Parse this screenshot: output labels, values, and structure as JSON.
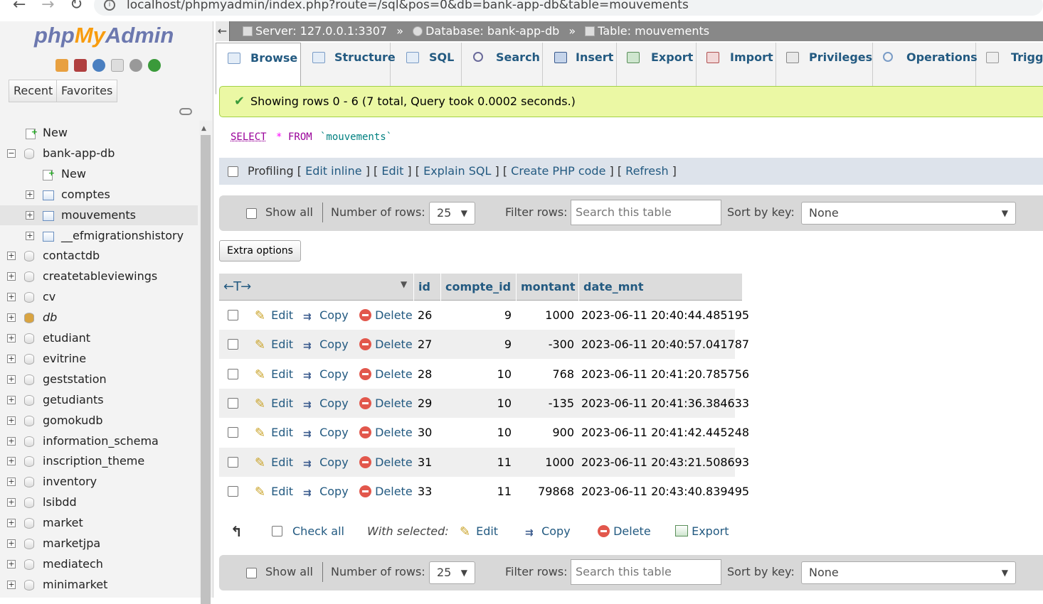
{
  "browser": {
    "back": "←",
    "forward": "→",
    "reload": "↻",
    "url": "localhost/phpmyadmin/index.php?route=/sql&pos=0&db=bank-app-db&table=mouvements"
  },
  "sidebar": {
    "logo": {
      "php": "php",
      "my": "My",
      "admin": "Admin"
    },
    "tabs": [
      "Recent",
      "Favorites"
    ],
    "tree": [
      {
        "label": "New",
        "type": "new",
        "level": 0
      },
      {
        "label": "bank-app-db",
        "type": "db",
        "level": 0,
        "expanded": true
      },
      {
        "label": "New",
        "type": "new",
        "level": 1
      },
      {
        "label": "comptes",
        "type": "table",
        "level": 1
      },
      {
        "label": "mouvements",
        "type": "table",
        "level": 1,
        "selected": true
      },
      {
        "label": "__efmigrationshistory",
        "type": "table",
        "level": 1
      },
      {
        "label": "contactdb",
        "type": "db",
        "level": 0
      },
      {
        "label": "createtableviewings",
        "type": "db",
        "level": 0
      },
      {
        "label": "cv",
        "type": "db",
        "level": 0
      },
      {
        "label": "db",
        "type": "db-special",
        "level": 0
      },
      {
        "label": "etudiant",
        "type": "db",
        "level": 0
      },
      {
        "label": "evitrine",
        "type": "db",
        "level": 0
      },
      {
        "label": "geststation",
        "type": "db",
        "level": 0
      },
      {
        "label": "getudiants",
        "type": "db",
        "level": 0
      },
      {
        "label": "gomokudb",
        "type": "db",
        "level": 0
      },
      {
        "label": "information_schema",
        "type": "db",
        "level": 0
      },
      {
        "label": "inscription_theme",
        "type": "db",
        "level": 0
      },
      {
        "label": "inventory",
        "type": "db",
        "level": 0
      },
      {
        "label": "lsibdd",
        "type": "db",
        "level": 0
      },
      {
        "label": "market",
        "type": "db",
        "level": 0
      },
      {
        "label": "marketjpa",
        "type": "db",
        "level": 0
      },
      {
        "label": "mediatech",
        "type": "db",
        "level": 0
      },
      {
        "label": "minimarket",
        "type": "db",
        "level": 0
      }
    ]
  },
  "breadcrumb": {
    "server": "Server: 127.0.0.1:3307",
    "database": "Database: bank-app-db",
    "table": "Table: mouvements",
    "sep": "»"
  },
  "tabs": [
    "Browse",
    "Structure",
    "SQL",
    "Search",
    "Insert",
    "Export",
    "Import",
    "Privileges",
    "Operations",
    "Trigge"
  ],
  "message": "Showing rows 0 - 6 (7 total, Query took 0.0002 seconds.)",
  "sql": {
    "select": "SELECT",
    "star": "*",
    "from": "FROM",
    "table": "`mouvements`"
  },
  "profiling": {
    "label": "Profiling",
    "links": [
      "Edit inline",
      "Edit",
      "Explain SQL",
      "Create PHP code",
      "Refresh"
    ]
  },
  "navbar": {
    "show_all": "Show all",
    "rows_label": "Number of rows:",
    "rows_value": "25",
    "filter_label": "Filter rows:",
    "filter_placeholder": "Search this table",
    "sort_label": "Sort by key:",
    "sort_value": "None"
  },
  "extra_options": "Extra options",
  "grid": {
    "arrows": "←T→",
    "columns": [
      "id",
      "compte_id",
      "montant",
      "date_mnt"
    ],
    "actions": {
      "edit": "Edit",
      "copy": "Copy",
      "delete": "Delete"
    },
    "rows": [
      {
        "id": "26",
        "compte_id": "9",
        "montant": "1000",
        "date_mnt": "2023-06-11 20:40:44.485195"
      },
      {
        "id": "27",
        "compte_id": "9",
        "montant": "-300",
        "date_mnt": "2023-06-11 20:40:57.041787"
      },
      {
        "id": "28",
        "compte_id": "10",
        "montant": "768",
        "date_mnt": "2023-06-11 20:41:20.785756"
      },
      {
        "id": "29",
        "compte_id": "10",
        "montant": "-135",
        "date_mnt": "2023-06-11 20:41:36.384633"
      },
      {
        "id": "30",
        "compte_id": "10",
        "montant": "900",
        "date_mnt": "2023-06-11 20:41:42.445248"
      },
      {
        "id": "31",
        "compte_id": "11",
        "montant": "1000",
        "date_mnt": "2023-06-11 20:43:21.508693"
      },
      {
        "id": "33",
        "compte_id": "11",
        "montant": "79868",
        "date_mnt": "2023-06-11 20:43:40.839495"
      }
    ]
  },
  "with_selected": {
    "check_all": "Check all",
    "label": "With selected:",
    "edit": "Edit",
    "copy": "Copy",
    "delete": "Delete",
    "export": "Export"
  },
  "colors": {
    "link": "#235a81",
    "success_bg": "#ebf8a4",
    "breadcrumb_bg": "#888888"
  }
}
